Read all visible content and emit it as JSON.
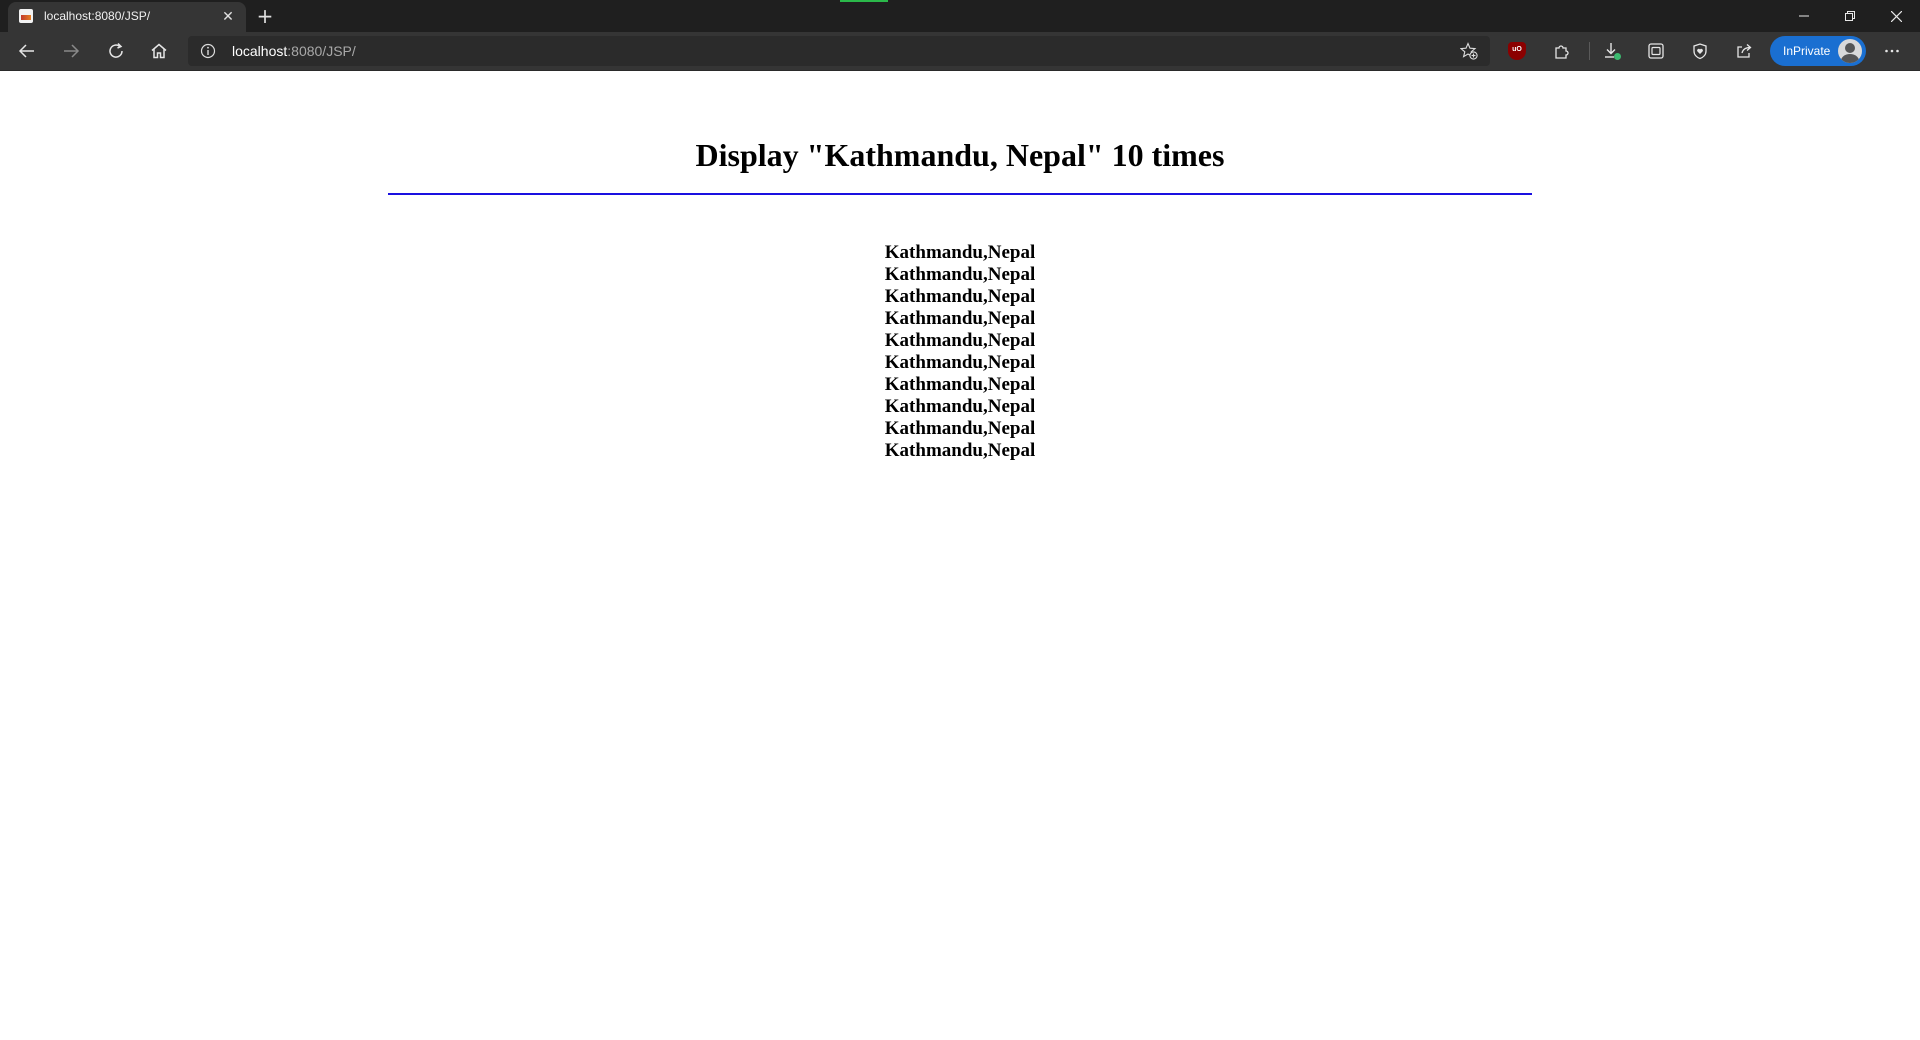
{
  "browser": {
    "tab": {
      "title": "localhost:8080/JSP/"
    },
    "address": {
      "host": "localhost",
      "path": ":8080/JSP/"
    },
    "profile": {
      "label": "InPrivate"
    },
    "extension_badge": "uO",
    "colors": {
      "inprivate": "#1a6fd1",
      "chrome": "#353535",
      "titlebar": "#1f1f1f"
    },
    "icons": {
      "back": "arrow-left-icon",
      "forward": "arrow-right-icon",
      "refresh": "refresh-icon",
      "home": "home-icon",
      "info": "info-icon",
      "favorites": "favorites-add-icon",
      "extensions": "puzzle-icon",
      "downloads": "download-icon",
      "collections": "collections-icon",
      "browser_essentials": "heart-shield-icon",
      "share": "share-icon",
      "more": "more-icon"
    }
  },
  "page": {
    "title": "Display \"Kathmandu, Nepal\" 10 times",
    "divider_color": "#1a10e0",
    "lines": [
      "Kathmandu,Nepal",
      "Kathmandu,Nepal",
      "Kathmandu,Nepal",
      "Kathmandu,Nepal",
      "Kathmandu,Nepal",
      "Kathmandu,Nepal",
      "Kathmandu,Nepal",
      "Kathmandu,Nepal",
      "Kathmandu,Nepal",
      "Kathmandu,Nepal"
    ]
  }
}
